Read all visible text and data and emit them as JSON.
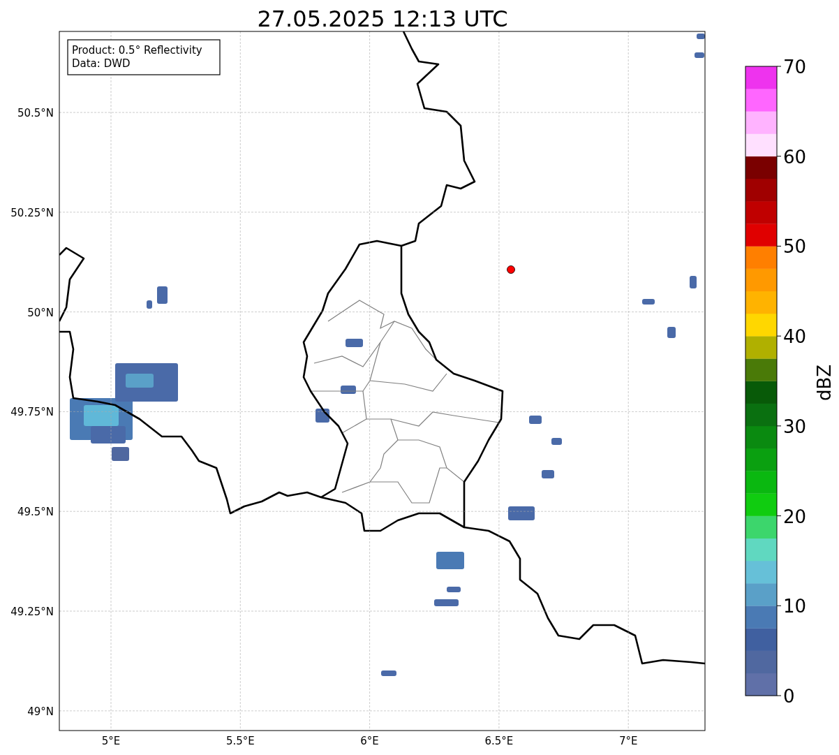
{
  "title": "27.05.2025 12:13 UTC",
  "info_box": {
    "lines": [
      "Product: 0.5° Reflectivity",
      "Data: DWD"
    ]
  },
  "map": {
    "lat_ticks": [
      "50.5°N",
      "50.25°N",
      "50°N",
      "49.75°N",
      "49.5°N",
      "49.25°N",
      "49°N"
    ],
    "lon_ticks": [
      "5°E",
      "5.5°E",
      "6°E",
      "6.5°E",
      "7°E"
    ]
  },
  "colorbar": {
    "label": "dBZ",
    "ticks": [
      "70",
      "60",
      "50",
      "40",
      "30",
      "20",
      "10",
      "0"
    ],
    "colors": [
      {
        "color": "#6070a8"
      },
      {
        "color": "#5068a0"
      },
      {
        "color": "#4060a0"
      },
      {
        "color": "#4a7ab4"
      },
      {
        "color": "#5aa0c8"
      },
      {
        "color": "#66c0d8"
      },
      {
        "color": "#60d8c0"
      },
      {
        "color": "#3cd66c"
      },
      {
        "color": "#10cc10"
      },
      {
        "color": "#0ab810"
      },
      {
        "color": "#0aa010"
      },
      {
        "color": "#0a8a10"
      },
      {
        "color": "#0a7010"
      },
      {
        "color": "#085a08"
      },
      {
        "color": "#4a7a08"
      },
      {
        "color": "#b0b000"
      },
      {
        "color": "#ffd700"
      },
      {
        "color": "#ffb300"
      },
      {
        "color": "#ff9900"
      },
      {
        "color": "#ff7f00"
      },
      {
        "color": "#e00000"
      },
      {
        "color": "#c00000"
      },
      {
        "color": "#a00000"
      },
      {
        "color": "#7a0000"
      },
      {
        "color": "#ffe0ff"
      },
      {
        "color": "#ffb3ff"
      },
      {
        "color": "#ff66ff"
      },
      {
        "color": "#ee33ee"
      }
    ]
  }
}
